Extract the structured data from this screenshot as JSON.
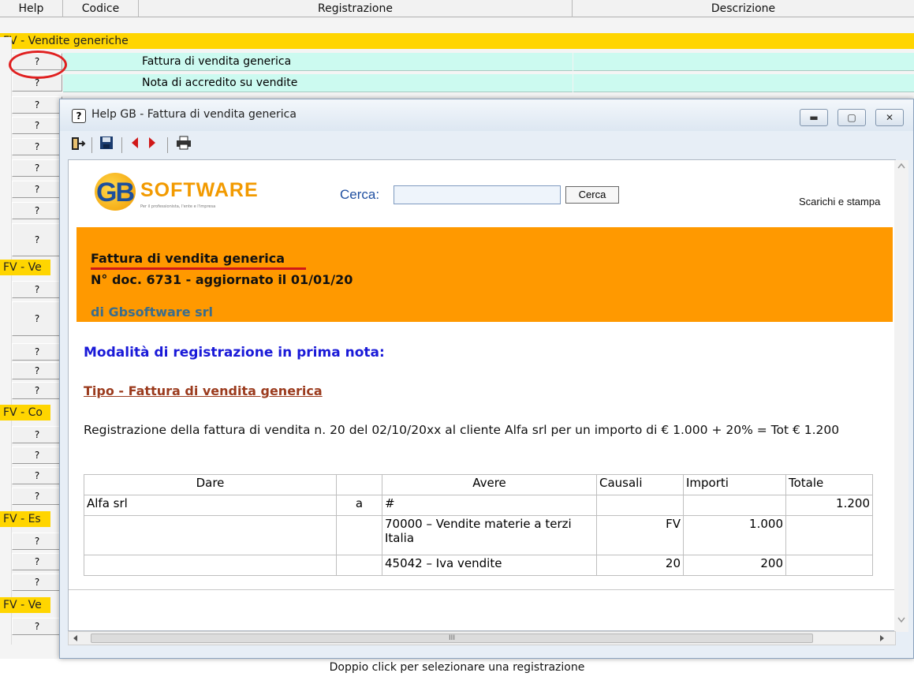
{
  "grid": {
    "columns": [
      "Help",
      "Codice",
      "Registrazione",
      "Descrizione"
    ],
    "group_first": "FV - Vendite generiche",
    "group_cut": [
      "FV - Ve",
      "FV - Co",
      "FV - Es",
      "FV - Ve"
    ],
    "help_symbol": "?",
    "rows": [
      {
        "registrazione": "Fattura di vendita  generica"
      },
      {
        "registrazione": "Nota di accredito su vendite"
      }
    ]
  },
  "status_text": "Doppio click per selezionare una registrazione",
  "help_window": {
    "title": "Help GB - Fattura di vendita generica",
    "title_icon": "?",
    "logo": {
      "mark": "GB",
      "word": "SOFTWARE",
      "tagline": "Per il professionista, l'ente e l'impresa"
    },
    "search": {
      "label": "Cerca:",
      "value": "",
      "button": "Cerca"
    },
    "downloads_link": "Scarichi e stampa",
    "doc_title": "Fattura di vendita generica",
    "doc_meta": "N° doc. 6731 - aggiornato il 01/01/20",
    "doc_author": "di  Gbsoftware srl",
    "section_heading": "Modalità  di registrazione in prima nota:",
    "type_heading": "Tipo -  Fattura di vendita generica",
    "description": "Registrazione della fattura di vendita n. 20 del 02/10/20xx al cliente Alfa srl per un importo di € 1.000 + 20% = Tot € 1.200",
    "table": {
      "headers": [
        "Dare",
        "",
        "Avere",
        "Causali",
        "Importi",
        "Totale"
      ],
      "rows": [
        [
          "Alfa srl",
          "a",
          "#",
          "",
          "",
          "1.200"
        ],
        [
          "",
          "",
          "70000 – Vendite materie a terzi Italia",
          "FV",
          "1.000",
          ""
        ],
        [
          "",
          "",
          "45042 – Iva vendite",
          "20",
          "200",
          ""
        ]
      ]
    },
    "hscroll_grip": "III"
  }
}
